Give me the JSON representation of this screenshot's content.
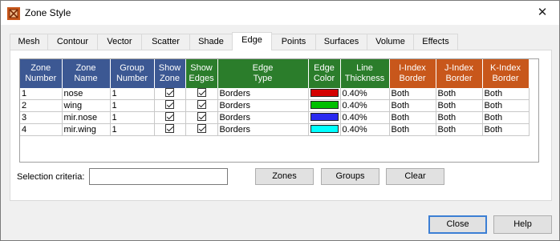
{
  "window": {
    "title": "Zone Style",
    "icon": "zone-style-app-icon",
    "close_label": "✕"
  },
  "tabs": [
    {
      "label": "Mesh"
    },
    {
      "label": "Contour"
    },
    {
      "label": "Vector"
    },
    {
      "label": "Scatter"
    },
    {
      "label": "Shade"
    },
    {
      "label": "Edge",
      "active": true
    },
    {
      "label": "Points"
    },
    {
      "label": "Surfaces"
    },
    {
      "label": "Volume"
    },
    {
      "label": "Effects"
    }
  ],
  "table": {
    "headers": [
      {
        "line1": "Zone",
        "line2": "Number",
        "color": "blue"
      },
      {
        "line1": "Zone",
        "line2": "Name",
        "color": "blue"
      },
      {
        "line1": "Group",
        "line2": "Number",
        "color": "blue"
      },
      {
        "line1": "Show",
        "line2": "Zone",
        "color": "blue"
      },
      {
        "line1": "Show",
        "line2": "Edges",
        "color": "green"
      },
      {
        "line1": "Edge",
        "line2": "Type",
        "color": "green"
      },
      {
        "line1": "Edge",
        "line2": "Color",
        "color": "green"
      },
      {
        "line1": "Line",
        "line2": "Thickness",
        "color": "green"
      },
      {
        "line1": "I-Index",
        "line2": "Border",
        "color": "orange"
      },
      {
        "line1": "J-Index",
        "line2": "Border",
        "color": "orange"
      },
      {
        "line1": "K-Index",
        "line2": "Border",
        "color": "orange"
      }
    ],
    "rows": [
      {
        "number": "1",
        "name": "nose",
        "group": "1",
        "show_zone": true,
        "show_edges": true,
        "edge_type": "Borders",
        "edge_color": "#d40000",
        "thickness": "0.40%",
        "i_border": "Both",
        "j_border": "Both",
        "k_border": "Both"
      },
      {
        "number": "2",
        "name": "wing",
        "group": "1",
        "show_zone": true,
        "show_edges": true,
        "edge_type": "Borders",
        "edge_color": "#00c000",
        "thickness": "0.40%",
        "i_border": "Both",
        "j_border": "Both",
        "k_border": "Both"
      },
      {
        "number": "3",
        "name": "mir.nose",
        "group": "1",
        "show_zone": true,
        "show_edges": true,
        "edge_type": "Borders",
        "edge_color": "#2a2af0",
        "thickness": "0.40%",
        "i_border": "Both",
        "j_border": "Both",
        "k_border": "Both"
      },
      {
        "number": "4",
        "name": "mir.wing",
        "group": "1",
        "show_zone": true,
        "show_edges": true,
        "edge_type": "Borders",
        "edge_color": "#00ffff",
        "thickness": "0.40%",
        "i_border": "Both",
        "j_border": "Both",
        "k_border": "Both"
      }
    ]
  },
  "selection": {
    "label": "Selection criteria:",
    "value": "",
    "zones_label": "Zones",
    "groups_label": "Groups",
    "clear_label": "Clear"
  },
  "dialog": {
    "close_label": "Close",
    "help_label": "Help"
  },
  "colors": {
    "header_blue": "#3c5893",
    "header_green": "#2b7d2b",
    "header_orange": "#c8571b",
    "default_button_border": "#3c7fd4"
  }
}
